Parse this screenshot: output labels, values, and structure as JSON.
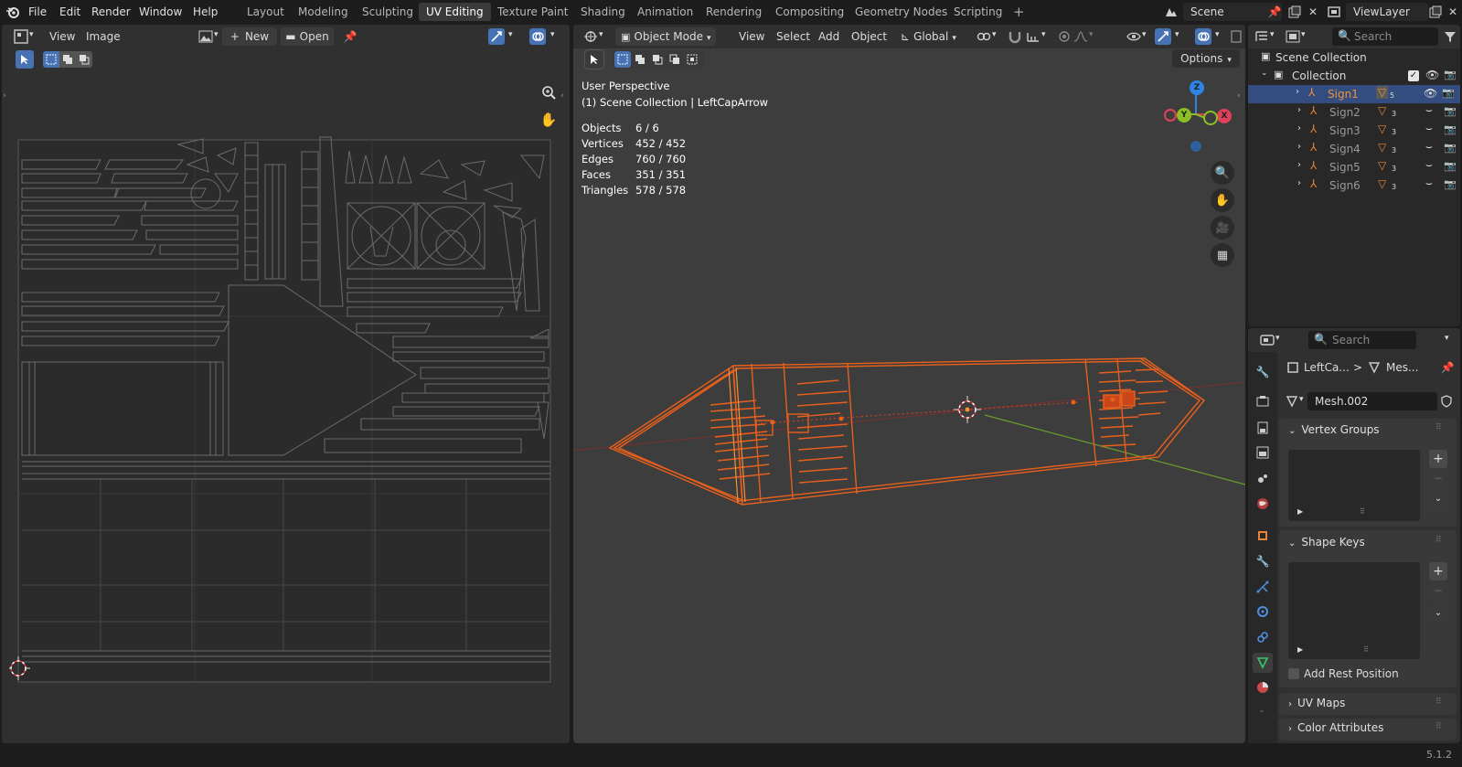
{
  "topbar": {
    "menus": [
      "File",
      "Edit",
      "Render",
      "Window",
      "Help"
    ],
    "workspaces": [
      "Layout",
      "Modeling",
      "Sculpting",
      "UV Editing",
      "Texture Paint",
      "Shading",
      "Animation",
      "Rendering",
      "Compositing",
      "Geometry Nodes",
      "Scripting"
    ],
    "active_workspace": "UV Editing",
    "add_tab": "+",
    "scene_name": "Scene",
    "viewlayer_name": "ViewLayer"
  },
  "uv_editor": {
    "menu_view": "View",
    "menu_image": "Image",
    "new_label": "New",
    "open_label": "Open"
  },
  "viewport": {
    "mode": "Object Mode",
    "menu_view": "View",
    "menu_select": "Select",
    "menu_add": "Add",
    "menu_object": "Object",
    "transform_orientation": "Global",
    "options_label": "Options",
    "perspective_label": "User Perspective",
    "collection_label": "(1) Scene Collection | LeftCapArrow",
    "stats": [
      {
        "label": "Objects",
        "value": "6 / 6"
      },
      {
        "label": "Vertices",
        "value": "452 / 452"
      },
      {
        "label": "Edges",
        "value": "760 / 760"
      },
      {
        "label": "Faces",
        "value": "351 / 351"
      },
      {
        "label": "Triangles",
        "value": "578 / 578"
      }
    ],
    "gizmo": {
      "x": "X",
      "y": "Y",
      "z": "Z"
    }
  },
  "outliner": {
    "search_placeholder": "Search",
    "root": "Scene Collection",
    "collection": "Collection",
    "objects": [
      {
        "name": "Sign1",
        "mod_count": "5",
        "active": true
      },
      {
        "name": "Sign2",
        "mod_count": "3",
        "active": false
      },
      {
        "name": "Sign3",
        "mod_count": "3",
        "active": false
      },
      {
        "name": "Sign4",
        "mod_count": "3",
        "active": false
      },
      {
        "name": "Sign5",
        "mod_count": "3",
        "active": false
      },
      {
        "name": "Sign6",
        "mod_count": "3",
        "active": false
      }
    ]
  },
  "properties": {
    "search_placeholder": "Search",
    "breadcrumb_object": "LeftCa...",
    "breadcrumb_sep": ">",
    "breadcrumb_mesh": "Mes...",
    "mesh_name": "Mesh.002",
    "sections": {
      "vertex_groups": "Vertex Groups",
      "shape_keys": "Shape Keys",
      "add_rest_position": "Add Rest Position",
      "uv_maps": "UV Maps",
      "color_attributes": "Color Attributes"
    }
  },
  "statusbar": {
    "version": "5.1.2"
  },
  "colors": {
    "accent_blue": "#4772b3",
    "selected_orange": "#f29236",
    "outline_orange": "#e8601c",
    "axis_x": "#e0415a",
    "axis_y": "#8cbf26",
    "axis_z": "#2f84e3"
  }
}
